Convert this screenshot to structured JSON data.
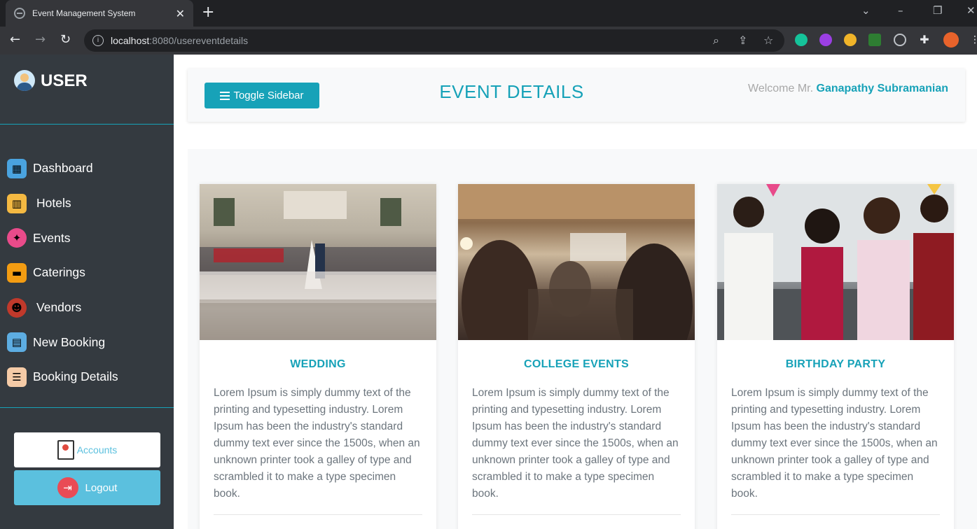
{
  "browser": {
    "tab_title": "Event Management System",
    "url_host": "localhost",
    "url_rest": ":8080/usereventdetails",
    "icons": [
      "globe-icon",
      "close-icon",
      "plus-icon",
      "back-icon",
      "forward-icon",
      "reload-icon",
      "info-icon",
      "zoom-icon",
      "share-icon",
      "star-icon",
      "puzzle-icon"
    ]
  },
  "sidebar": {
    "title": "USER",
    "items": [
      {
        "label": "Dashboard",
        "icon": "dashboard-icon",
        "color": "#4aa3df"
      },
      {
        "label": "Hotels",
        "icon": "hotel-icon",
        "color": "#f4b942"
      },
      {
        "label": "Events",
        "icon": "events-icon",
        "color": "#e94b8a"
      },
      {
        "label": "Caterings",
        "icon": "catering-icon",
        "color": "#f39c12"
      },
      {
        "label": "Vendors",
        "icon": "vendor-icon",
        "color": "#c0392b"
      },
      {
        "label": "New Booking",
        "icon": "new-booking-icon",
        "color": "#5dade2"
      },
      {
        "label": "Booking Details",
        "icon": "booking-details-icon",
        "color": "#f5cba7"
      }
    ],
    "accounts_label": "Accounts",
    "logout_label": "Logout"
  },
  "header": {
    "toggle_label": "Toggle Sidebar",
    "title": "EVENT DETAILS",
    "welcome_prefix": "Welcome Mr. ",
    "user_name": "Ganapathy Subramanian"
  },
  "cards": [
    {
      "title": "WEDDING",
      "text": "Lorem Ipsum is simply dummy text of the printing and typesetting industry. Lorem Ipsum has been the industry's standard dummy text ever since the 1500s, when an unknown printer took a galley of type and scrambled it to make a type specimen book."
    },
    {
      "title": "COLLEGE EVENTS",
      "text": "Lorem Ipsum is simply dummy text of the printing and typesetting industry. Lorem Ipsum has been the industry's standard dummy text ever since the 1500s, when an unknown printer took a galley of type and scrambled it to make a type specimen book."
    },
    {
      "title": "BIRTHDAY PARTY",
      "text": "Lorem Ipsum is simply dummy text of the printing and typesetting industry. Lorem Ipsum has been the industry's standard dummy text ever since the 1500s, when an unknown printer took a galley of type and scrambled it to make a type specimen book."
    }
  ],
  "colors": {
    "accent": "#17a2b8",
    "sidebar_bg": "#343a40",
    "logout_bg": "#5bc0de"
  }
}
